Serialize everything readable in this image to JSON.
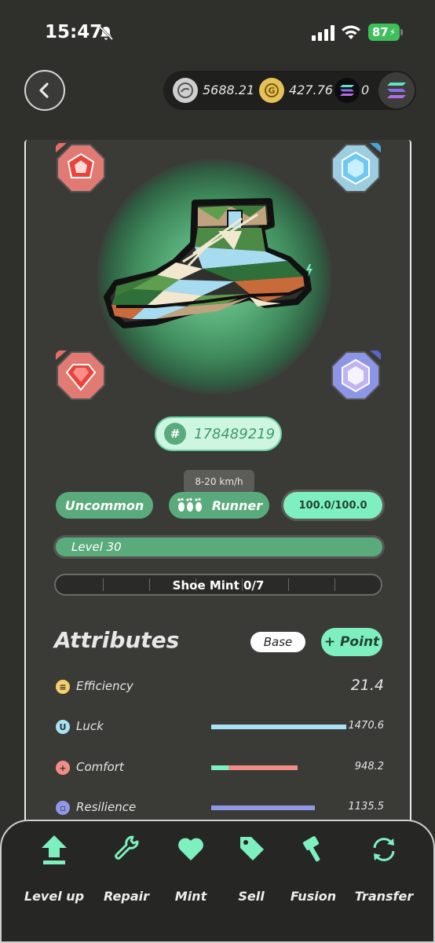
{
  "status_bar": {
    "time": "15:47",
    "battery": "87"
  },
  "wallet": [
    {
      "icon": "gst-coin-icon",
      "value": "5688.21"
    },
    {
      "icon": "gmt-coin-icon",
      "value": "427.76"
    },
    {
      "icon": "sol-coin-icon",
      "value": "0"
    }
  ],
  "shoe": {
    "id_prefix": "#",
    "id": "178489219",
    "speed": "8-20 km/h",
    "rarity": "Uncommon",
    "type": "Runner",
    "durability": "100.0/100.0",
    "level": "Level 30",
    "mint": "Shoe Mint 0/7"
  },
  "attributes": {
    "title": "Attributes",
    "tab_base": "Base",
    "tab_point": "+ Point",
    "items": [
      {
        "label": "Efficiency",
        "value": "21.4",
        "color": "#f4d06a",
        "bar_fraction": 0.0
      },
      {
        "label": "Luck",
        "value": "1470.6",
        "color": "#a7e3f5",
        "bar_fraction": 1.0
      },
      {
        "label": "Comfort",
        "value": "948.2",
        "color": "#f08e86",
        "bar_fraction": 0.63
      },
      {
        "label": "Resilience",
        "value": "1135.5",
        "color": "#8f98e6",
        "bar_fraction": 0.77
      }
    ]
  },
  "actions": [
    {
      "label": "Level up",
      "icon": "level-up-icon"
    },
    {
      "label": "Repair",
      "icon": "wrench-icon"
    },
    {
      "label": "Mint",
      "icon": "heart-icon"
    },
    {
      "label": "Sell",
      "icon": "tag-icon"
    },
    {
      "label": "Fusion",
      "icon": "hammer-icon"
    },
    {
      "label": "Transfer",
      "icon": "transfer-icon"
    }
  ],
  "colors": {
    "accent": "#7ef0bf",
    "green": "#5aab7c",
    "background": "#2f2f2c"
  }
}
